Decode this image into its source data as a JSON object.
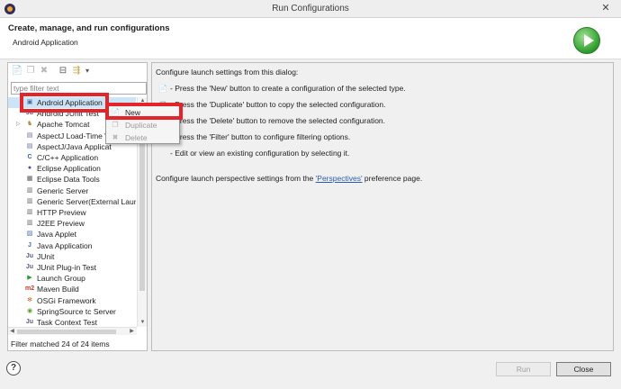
{
  "window": {
    "title": "Run Configurations",
    "close_glyph": "✕",
    "app_icon": "eclipse-icon"
  },
  "header": {
    "title": "Create, manage, and run configurations",
    "subtitle": "Android Application",
    "icon": "run-icon"
  },
  "left": {
    "filter_placeholder": "type filter text",
    "filter_value": "",
    "toolbar": [
      {
        "name": "new-configuration-icon",
        "glyph": "📄"
      },
      {
        "name": "duplicate-icon",
        "glyph": "❐"
      },
      {
        "name": "delete-icon",
        "glyph": "✖"
      },
      {
        "name": "collapse-all-icon",
        "glyph": "⊟"
      },
      {
        "name": "filter-icon",
        "glyph": "⇶"
      },
      {
        "name": "dropdown-icon",
        "glyph": "▾"
      }
    ],
    "tree": [
      {
        "label": "Android Application",
        "icon": "android-app-icon",
        "glyph": "▣",
        "color": "#4a6fa5",
        "twisty": ""
      },
      {
        "label": "Android JUnit Test",
        "icon": "junit-icon",
        "glyph": "Ju",
        "color": "#5a5a8a",
        "twisty": ""
      },
      {
        "label": "Apache Tomcat",
        "icon": "tomcat-icon",
        "glyph": "♞",
        "color": "#b58a3a",
        "twisty": "▷"
      },
      {
        "label": "AspectJ Load-Time W",
        "icon": "aspectj-icon",
        "glyph": "▤",
        "color": "#6a6aa0",
        "twisty": ""
      },
      {
        "label": "AspectJ/Java Applicat",
        "icon": "aspectj-icon",
        "glyph": "▤",
        "color": "#6a6aa0",
        "twisty": ""
      },
      {
        "label": "C/C++ Application",
        "icon": "cpp-icon",
        "glyph": "C",
        "color": "#3a5fa0",
        "twisty": ""
      },
      {
        "label": "Eclipse Application",
        "icon": "eclipse-icon",
        "glyph": "●",
        "color": "#5b4aa0",
        "twisty": ""
      },
      {
        "label": "Eclipse Data Tools",
        "icon": "data-tools-icon",
        "glyph": "▦",
        "color": "#555555",
        "twisty": ""
      },
      {
        "label": "Generic Server",
        "icon": "server-icon",
        "glyph": "▥",
        "color": "#666666",
        "twisty": ""
      },
      {
        "label": "Generic Server(External Launch",
        "icon": "server-icon",
        "glyph": "▥",
        "color": "#666666",
        "twisty": ""
      },
      {
        "label": "HTTP Preview",
        "icon": "http-preview-icon",
        "glyph": "▥",
        "color": "#666666",
        "twisty": ""
      },
      {
        "label": "J2EE Preview",
        "icon": "j2ee-preview-icon",
        "glyph": "▥",
        "color": "#666666",
        "twisty": ""
      },
      {
        "label": "Java Applet",
        "icon": "java-applet-icon",
        "glyph": "▨",
        "color": "#4a6fa5",
        "twisty": ""
      },
      {
        "label": "Java Application",
        "icon": "java-app-icon",
        "glyph": "J",
        "color": "#3a6ab0",
        "twisty": ""
      },
      {
        "label": "JUnit",
        "icon": "junit-icon",
        "glyph": "Ju",
        "color": "#5a5a8a",
        "twisty": ""
      },
      {
        "label": "JUnit Plug-in Test",
        "icon": "junit-icon",
        "glyph": "Ju",
        "color": "#5a5a8a",
        "twisty": ""
      },
      {
        "label": "Launch Group",
        "icon": "launch-group-icon",
        "glyph": "▶",
        "color": "#2e9a2e",
        "twisty": ""
      },
      {
        "label": "Maven Build",
        "icon": "maven-icon",
        "glyph": "m2",
        "color": "#c0392b",
        "twisty": ""
      },
      {
        "label": "OSGi Framework",
        "icon": "osgi-icon",
        "glyph": "✻",
        "color": "#c0702b",
        "twisty": ""
      },
      {
        "label": "SpringSource tc Server",
        "icon": "tc-server-icon",
        "glyph": "◉",
        "color": "#5aa02e",
        "twisty": ""
      },
      {
        "label": "Task Context Test",
        "icon": "junit-icon",
        "glyph": "Ju",
        "color": "#5a5a8a",
        "twisty": ""
      }
    ],
    "status": "Filter matched 24 of 24 items"
  },
  "right": {
    "intro": "Configure launch settings from this dialog:",
    "bullets": [
      {
        "text": "- Press the 'New' button to create a configuration of the selected type.",
        "icon": "new-configuration-icon",
        "glyph": "📄"
      },
      {
        "text": "- Press the 'Duplicate' button to copy the selected configuration.",
        "icon": "duplicate-icon",
        "glyph": "❐"
      },
      {
        "text": "- Press the 'Delete' button to remove the selected configuration.",
        "icon": "delete-icon",
        "glyph": "✖"
      },
      {
        "text": "- Press the 'Filter' button to configure filtering options.",
        "icon": "filter-icon",
        "glyph": "⇶"
      },
      {
        "text": "- Edit or view an existing configuration by selecting it.",
        "icon": "",
        "glyph": ""
      }
    ],
    "perspective_prefix": "Configure launch perspective settings from the ",
    "perspective_link": "'Perspectives'",
    "perspective_suffix": " preference page."
  },
  "context_menu": {
    "items": [
      {
        "label": "New",
        "enabled": true,
        "icon": "new-icon",
        "glyph": "📄"
      },
      {
        "label": "Duplicate",
        "enabled": false,
        "icon": "duplicate-icon",
        "glyph": "❐"
      },
      {
        "label": "Delete",
        "enabled": false,
        "icon": "delete-icon",
        "glyph": "✖"
      }
    ]
  },
  "footer": {
    "help_glyph": "?",
    "run_label": "Run",
    "close_label": "Close"
  },
  "colors": {
    "highlight": "#e3242b",
    "link": "#2a5db0",
    "selection": "#cce4f7"
  }
}
